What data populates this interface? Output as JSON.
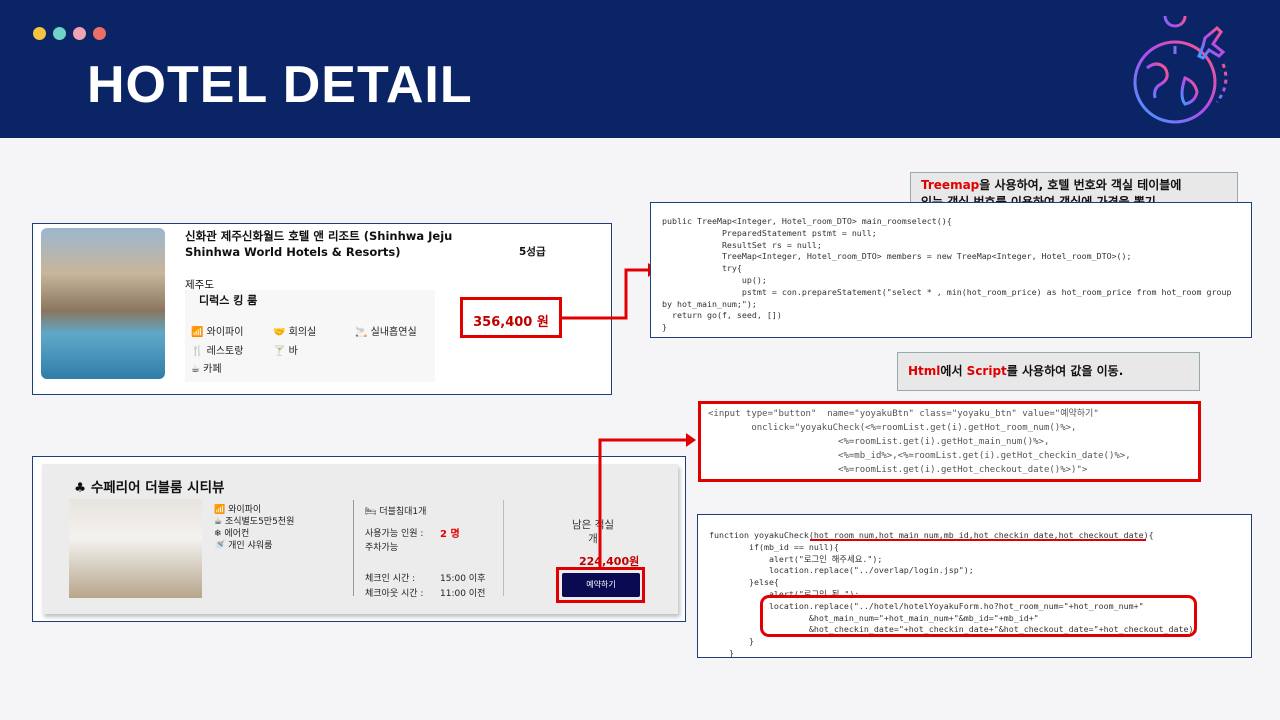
{
  "header": {
    "title": "HOTEL DETAIL",
    "dot_colors": [
      "#f5c542",
      "#6fd3c8",
      "#f0a3b3",
      "#ec6e64"
    ]
  },
  "hotel_card": {
    "name_line1": "신화관 제주신화월드 호텔 앤 리조트 (Shinhwa Jeju",
    "name_line2": "Shinhwa World Hotels & Resorts)",
    "grade": "5성급",
    "region": "제주도",
    "room_name": "디럭스 킹 룸",
    "amenities": [
      "와이파이",
      "회의실",
      "실내흡연실",
      "레스토랑",
      "바",
      "카페"
    ],
    "price": "356,400 원"
  },
  "room_card": {
    "club_icon": "♣",
    "title": "수페리어 더블룸 시티뷰",
    "features": [
      "와이파이",
      "조식별도5만5천원",
      "에어컨",
      "개인 샤워룸"
    ],
    "bed": "더블침대1개",
    "capacity_label": "사용가능 인원 :",
    "capacity_value": "2 명",
    "parking": "주차가능",
    "checkin_label": "체크인 시간 :",
    "checkin_value": "15:00 이후",
    "checkout_label": "체크아웃 시간 :",
    "checkout_value": "11:00 이전",
    "remaining_line1": "남은 객실",
    "remaining_line2": "개",
    "price": "224,400원",
    "reserve_button": "예약하기"
  },
  "note1": {
    "highlight": "Treemap",
    "text_a": "을 사용하여, 호텔 번호와 객실 테이블에",
    "text_b": "있는 객실 번호를 이용하여 객실에 가격을 뽑기."
  },
  "note2": {
    "hl1": "Html",
    "t1": "에서 ",
    "hl2": "Script",
    "t2": "를 사용하여 값을 이동."
  },
  "code1": [
    "public TreeMap<Integer, Hotel_room_DTO> main_roomselect(){",
    "            PreparedStatement pstmt = null;",
    "            ResultSet rs = null;",
    "            TreeMap<Integer, Hotel_room_DTO> members = new TreeMap<Integer, Hotel_room_DTO>();",
    "            try{",
    "                up();",
    "                pstmt = con.prepareStatement(\"select * , min(hot_room_price) as hot_room_price from hot_room group",
    "by hot_main_num;\");",
    "  return go(f, seed, [])",
    "}"
  ],
  "code2": [
    "<input type=\"button\"  name=\"yoyakuBtn\" class=\"yoyaku_btn\" value=\"예약하기\"",
    "        onclick=\"yoyakuCheck(<%=roomList.get(i).getHot_room_num()%>,",
    "                        <%=roomList.get(i).getHot_main_num()%>,",
    "                        <%=mb_id%>,<%=roomList.get(i).getHot_checkin_date()%>,",
    "                        <%=roomList.get(i).getHot_checkout_date()%>)\">"
  ],
  "code3": [
    "function yoyakuCheck(hot_room_num,hot_main_num,mb_id,hot_checkin_date,hot_checkout_date){",
    "        if(mb_id == null){",
    "            alert(\"로그인 해주세요.\");",
    "            location.replace(\"../overlap/login.jsp\");",
    "        }else{",
    "            alert(\"로그인 됨.\");",
    "            location.replace(\"../hotel/hotelYoyakuForm.ho?hot_room_num=\"+hot_room_num+\"",
    "                    &hot_main_num=\"+hot_main_num+\"&mb_id=\"+mb_id+\"",
    "                    &hot_checkin_date=\"+hot_checkin_date+\"&hot_checkout_date=\"+hot_checkout_date);",
    "        }",
    "    }"
  ]
}
